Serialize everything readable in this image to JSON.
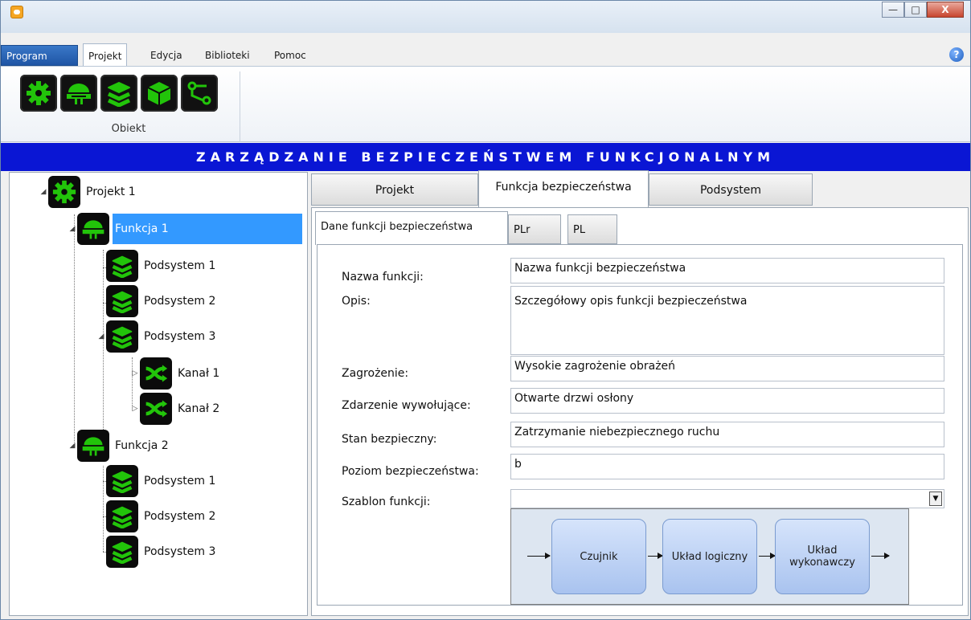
{
  "window": {
    "controls": [
      "—",
      "□",
      "X"
    ]
  },
  "menu": {
    "items": [
      "Program",
      "Projekt",
      "Edycja",
      "Biblioteki",
      "Pomoc"
    ],
    "help": "?"
  },
  "ribbon": {
    "group_label": "Obiekt",
    "buttons": [
      "gear-icon",
      "function-icon",
      "layers-icon",
      "cube-icon",
      "connection-icon"
    ]
  },
  "banner": {
    "title": "ZARZĄDZANIE BEZPIECZEŃSTWEM FUNKCJONALNYM"
  },
  "tree": {
    "project": "Projekt 1",
    "function1": "Funkcja 1",
    "f1_sub1": "Podsystem 1",
    "f1_sub2": "Podsystem 2",
    "f1_sub3": "Podsystem 3",
    "channel1": "Kanał 1",
    "channel2": "Kanał 2",
    "function2": "Funkcja 2",
    "f2_sub1": "Podsystem 1",
    "f2_sub2": "Podsystem 2",
    "f2_sub3": "Podsystem 3"
  },
  "tabs": {
    "project": "Projekt",
    "safety_function": "Funkcja bezpieczeństwa",
    "subsystem": "Podsystem"
  },
  "subtabs": {
    "data": "Dane funkcji bezpieczeństwa",
    "plr": "PLr",
    "pl": "PL"
  },
  "form": {
    "name_label": "Nazwa funkcji:",
    "name_value": "Nazwa funkcji bezpieczeństwa",
    "desc_label": "Opis:",
    "desc_value": "Szczegółowy opis funkcji bezpieczeństwa",
    "hazard_label": "Zagrożenie:",
    "hazard_value": "Wysokie zagrożenie obrażeń",
    "event_label": "Zdarzenie wywołujące:",
    "event_value": "Otwarte drzwi osłony",
    "state_label": "Stan bezpieczny:",
    "state_value": "Zatrzymanie niebezpiecznego ruchu",
    "level_label": "Poziom bezpieczeństwa:",
    "level_value": "b",
    "template_label": "Szablon funkcji:",
    "template_value": ""
  },
  "diagram": {
    "sensor": "Czujnik",
    "logic": "Układ logiczny",
    "actuator": "Układ wykonawczy"
  },
  "colors": {
    "banner": "#0a16d4",
    "selected": "#3399ff",
    "icon_green": "#22c40a"
  }
}
